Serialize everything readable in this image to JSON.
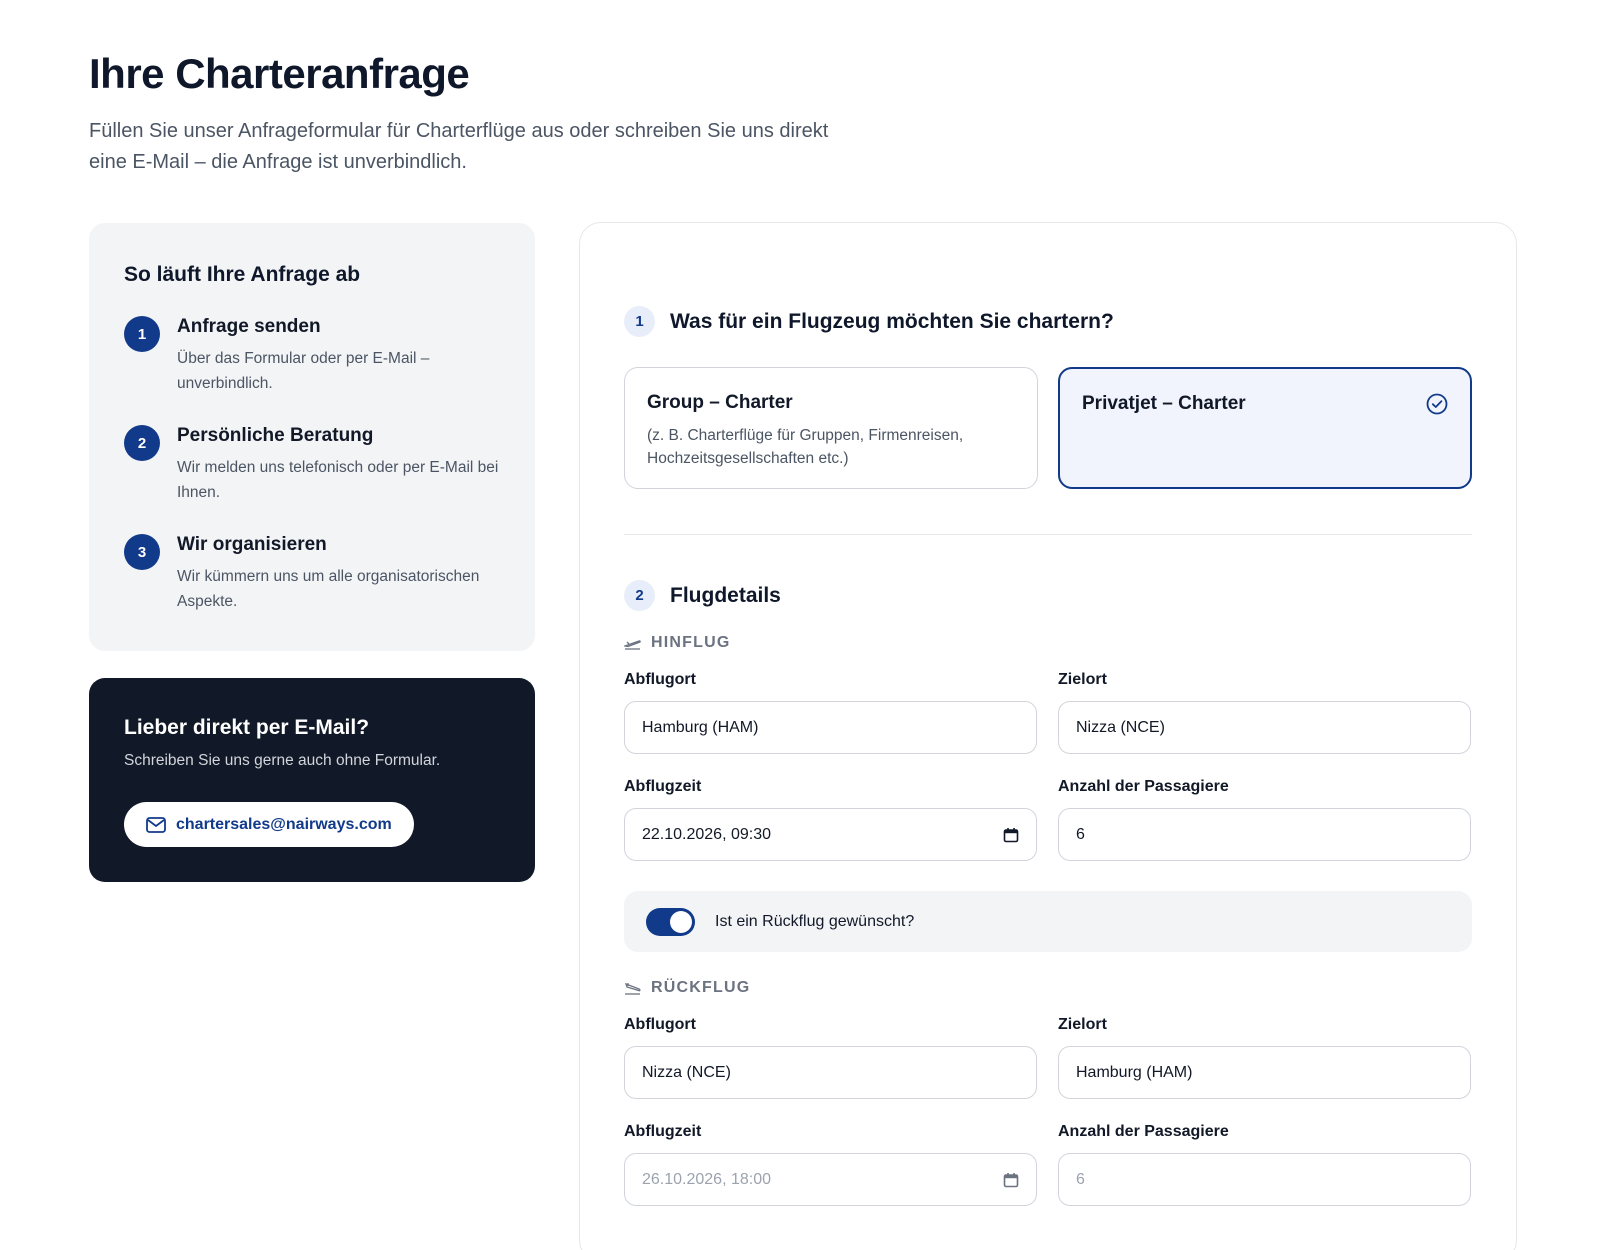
{
  "header": {
    "title": "Ihre Charteranfrage",
    "intro": "Füllen Sie unser Anfrageformular für Charterflüge aus oder schreiben Sie uns direkt eine E-Mail – die Anfrage ist unverbindlich."
  },
  "steps": {
    "title": "So läuft Ihre Anfrage ab",
    "items": [
      {
        "num": "1",
        "title": "Anfrage senden",
        "desc": "Über das Formular oder per E-Mail – unverbindlich."
      },
      {
        "num": "2",
        "title": "Persönliche Beratung",
        "desc": "Wir melden uns telefonisch oder per E-Mail bei Ihnen."
      },
      {
        "num": "3",
        "title": "Wir organisieren",
        "desc": "Wir kümmern uns um alle organisatorischen Aspekte."
      }
    ]
  },
  "email_card": {
    "title": "Lieber direkt per E-Mail?",
    "text": "Schreiben Sie uns gerne auch ohne Formular.",
    "email": "chartersales@nairways.com"
  },
  "form": {
    "section1": {
      "num": "1",
      "title": "Was für ein Flugzeug möchten Sie chartern?",
      "options": [
        {
          "title": "Group – Charter",
          "sub": "(z. B. Charterflüge für Gruppen, Firmenreisen, Hochzeitsgesellschaften etc.)",
          "selected": false
        },
        {
          "title": "Privatjet – Charter",
          "sub": "",
          "selected": true
        }
      ]
    },
    "section2": {
      "num": "2",
      "title": "Flugdetails",
      "outbound": {
        "label": "HINFLUG",
        "from_label": "Abflugort",
        "from_value": "Hamburg (HAM)",
        "to_label": "Zielort",
        "to_value": "Nizza (NCE)",
        "time_label": "Abflugzeit",
        "time_value": "22.10.2026, 09:30",
        "pax_label": "Anzahl der Passagiere",
        "pax_value": "6"
      },
      "return_toggle": {
        "label": "Ist ein Rückflug gewünscht?",
        "on": true
      },
      "inbound": {
        "label": "RÜCKFLUG",
        "from_label": "Abflugort",
        "from_value": "Nizza (NCE)",
        "to_label": "Zielort",
        "to_value": "Hamburg (HAM)",
        "time_label": "Abflugzeit",
        "time_value": "26.10.2026, 18:00",
        "pax_label": "Anzahl der Passagiere",
        "pax_value": "6"
      }
    }
  },
  "colors": {
    "accent": "#123a8a",
    "dark_card": "#111827",
    "muted_bg": "#f3f4f6"
  }
}
